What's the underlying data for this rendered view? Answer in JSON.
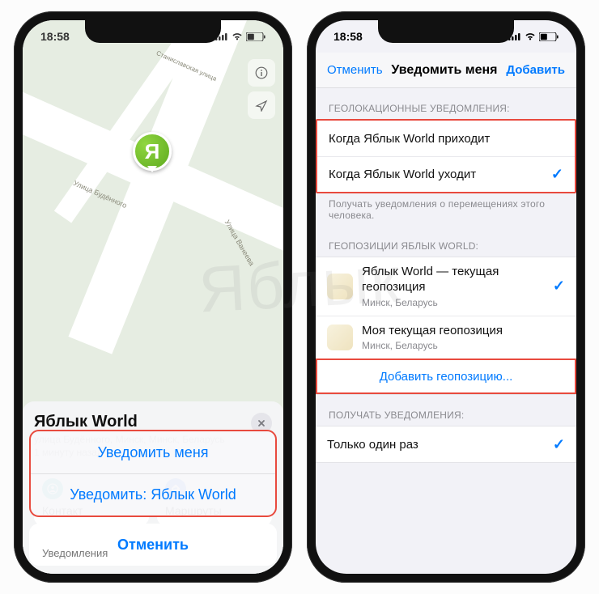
{
  "status": {
    "time": "18:58",
    "lock_icon": "lock-icon"
  },
  "phone1": {
    "map": {
      "street1": "Улица Будённого",
      "street2": "Станиславская улица",
      "street3": "Улица Ванеева"
    },
    "pin_letter": "Я",
    "sheet": {
      "title": "Яблык World",
      "address": "улица Будённого, Минск, Минск, Беларусь",
      "time_ago": "1 минуту назад",
      "card_contact": "Контакт",
      "card_routes": "Маршруты",
      "peek_label": "Уведомления"
    },
    "action_sheet": {
      "notify_me": "Уведомить меня",
      "notify_other": "Уведомить: Яблык World",
      "cancel": "Отменить"
    }
  },
  "phone2": {
    "nav": {
      "cancel": "Отменить",
      "title": "Уведомить меня",
      "add": "Добавить"
    },
    "sec1_label": "ГЕОЛОКАЦИОННЫЕ УВЕДОМЛЕНИЯ:",
    "sec1": {
      "arrives": "Когда Яблык World приходит",
      "leaves": "Когда Яблык World уходит"
    },
    "sec1_footer": "Получать уведомления о перемещениях этого человека.",
    "sec2_label": "ГЕОПОЗИЦИИ ЯБЛЫК WORLD:",
    "sec2": {
      "loc1_title": "Яблык World — текущая геопозиция",
      "loc1_sub": "Минск, Беларусь",
      "loc2_title": "Моя текущая геопозиция",
      "loc2_sub": "Минск, Беларусь",
      "add_location": "Добавить геопозицию..."
    },
    "sec3_label": "ПОЛУЧАТЬ УВЕДОМЛЕНИЯ:",
    "sec3": {
      "once": "Только один раз"
    }
  },
  "watermark": "Яблык"
}
